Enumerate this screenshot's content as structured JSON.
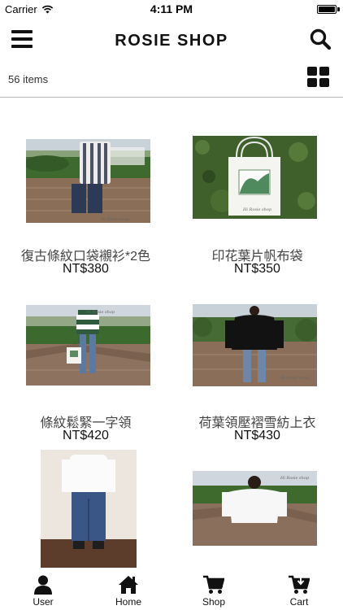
{
  "status_bar": {
    "carrier": "Carrier",
    "time": "4:11 PM",
    "battery_level": 1.0
  },
  "nav": {
    "title": "ROSIE SHOP",
    "menu_icon": "hamburger-menu-icon",
    "search_icon": "magnifier-icon"
  },
  "toolbar": {
    "item_count": "56 items",
    "view_icon": "grid-view-icon"
  },
  "products": [
    {
      "name": "復古條紋口袋襯衫*2色",
      "price": "NT$380",
      "image": "striped-shirt-photo"
    },
    {
      "name": "印花葉片帆布袋",
      "price": "NT$350",
      "image": "leaf-tote-bag-photo"
    },
    {
      "name": "條紋鬆緊一字領",
      "price": "NT$420",
      "image": "striped-off-shoulder-top-photo"
    },
    {
      "name": "荷葉領壓褶雪紡上衣",
      "price": "NT$430",
      "image": "black-ruffle-blouse-photo"
    },
    {
      "name": "",
      "price": "",
      "image": "white-top-blue-pants-photo"
    },
    {
      "name": "",
      "price": "",
      "image": "white-off-shoulder-top-photo"
    }
  ],
  "watermark": "Hi Rosie shop",
  "tabs": [
    {
      "label": "User",
      "icon": "user-icon"
    },
    {
      "label": "Home",
      "icon": "home-icon"
    },
    {
      "label": "Shop",
      "icon": "shopping-cart-icon"
    },
    {
      "label": "Cart",
      "icon": "cart-download-icon"
    }
  ]
}
